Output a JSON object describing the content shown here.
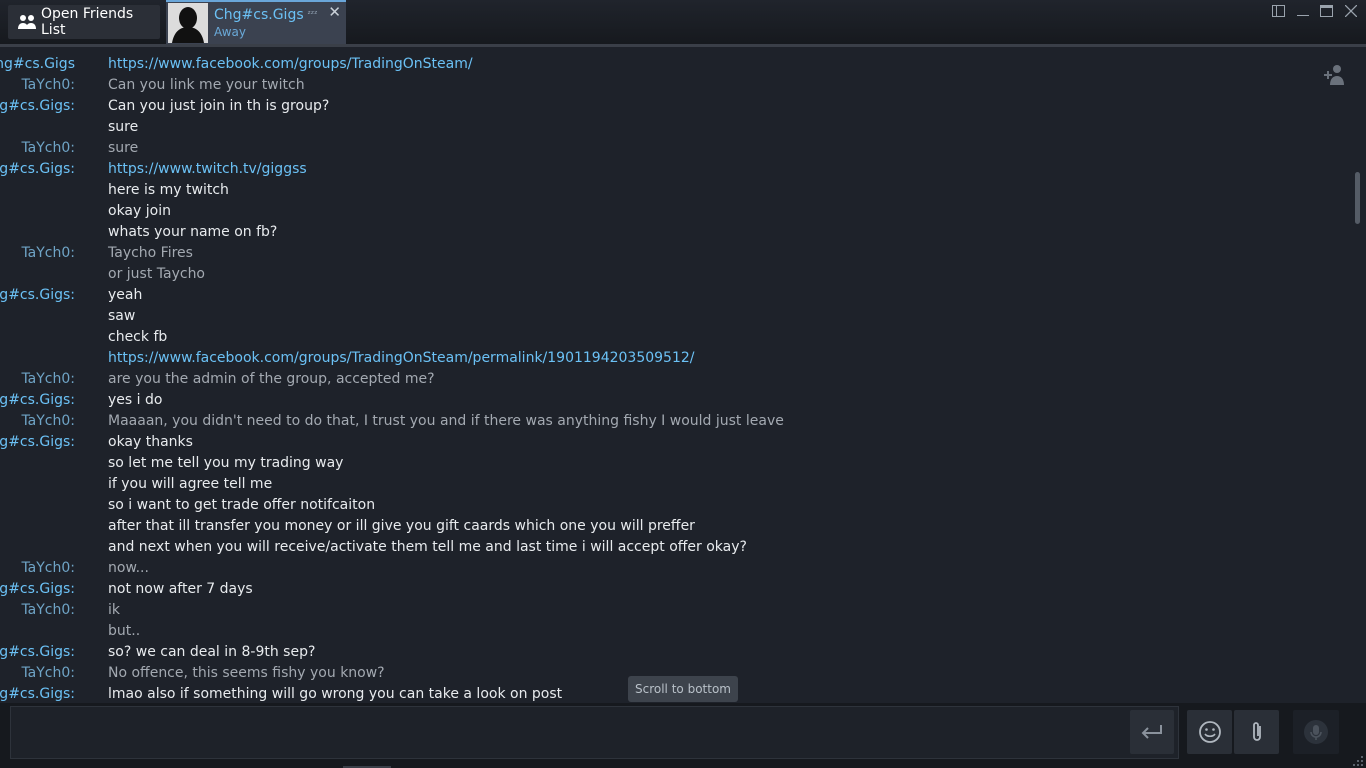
{
  "topbar": {
    "friends_button_label": "Open Friends List",
    "tab": {
      "name": "Chg#cs.Gigs",
      "status": "Away",
      "sleep_indicator": "ᶻᶻᶻ",
      "close_glyph": "✕"
    }
  },
  "chat": {
    "messages": [
      {
        "who": "Chg#cs.Gigs",
        "text": "https://www.facebook.com/groups/TradingOnSteam/",
        "side": "me",
        "link": true
      },
      {
        "who": "TaYch0:",
        "text": "Can you link me your twitch",
        "side": "them"
      },
      {
        "who": "Chg#cs.Gigs:",
        "text": "Can you just join in th is group?",
        "side": "me"
      },
      {
        "who": "",
        "text": "sure",
        "side": "me"
      },
      {
        "who": "TaYch0:",
        "text": "sure",
        "side": "them"
      },
      {
        "who": "Chg#cs.Gigs:",
        "text": "https://www.twitch.tv/giggss",
        "side": "me",
        "link": true
      },
      {
        "who": "",
        "text": "here is my twitch",
        "side": "me"
      },
      {
        "who": "",
        "text": "okay join",
        "side": "me"
      },
      {
        "who": "",
        "text": "whats your name on fb?",
        "side": "me"
      },
      {
        "who": "TaYch0:",
        "text": "Taycho Fires",
        "side": "them"
      },
      {
        "who": "",
        "text": "or just Taycho",
        "side": "them"
      },
      {
        "who": "Chg#cs.Gigs:",
        "text": "yeah",
        "side": "me"
      },
      {
        "who": "",
        "text": "saw",
        "side": "me"
      },
      {
        "who": "",
        "text": "check fb",
        "side": "me"
      },
      {
        "who": "",
        "text": "https://www.facebook.com/groups/TradingOnSteam/permalink/1901194203509512/",
        "side": "me",
        "link": true
      },
      {
        "who": "TaYch0:",
        "text": "are you the admin of the group, accepted me?",
        "side": "them"
      },
      {
        "who": "Chg#cs.Gigs:",
        "text": "yes i do",
        "side": "me"
      },
      {
        "who": "TaYch0:",
        "text": "Maaaan, you didn't need to do that, I trust you and if there was anything fishy I would just leave",
        "side": "them"
      },
      {
        "who": "Chg#cs.Gigs:",
        "text": "okay thanks",
        "side": "me"
      },
      {
        "who": "",
        "text": "so let me tell you my trading way",
        "side": "me"
      },
      {
        "who": "",
        "text": "if you will agree tell me",
        "side": "me"
      },
      {
        "who": "",
        "text": "so i want to get trade offer notifcaiton",
        "side": "me"
      },
      {
        "who": "",
        "text": "after that ill transfer you money or ill give you gift caards which one you will preffer",
        "side": "me"
      },
      {
        "who": "",
        "text": "and next when you will receive/activate them tell me and last time i will accept offer okay?",
        "side": "me"
      },
      {
        "who": "TaYch0:",
        "text": "now...",
        "side": "them"
      },
      {
        "who": "Chg#cs.Gigs:",
        "text": "not now after 7 days",
        "side": "me"
      },
      {
        "who": "TaYch0:",
        "text": "ik",
        "side": "them"
      },
      {
        "who": "",
        "text": "but..",
        "side": "them"
      },
      {
        "who": "Chg#cs.Gigs:",
        "text": "so? we can deal in 8-9th sep?",
        "side": "me"
      },
      {
        "who": "TaYch0:",
        "text": "No offence, this seems fishy you know?",
        "side": "them"
      },
      {
        "who": "Chg#cs.Gigs:",
        "text": "lmao also if something will go wrong you can take a look on post",
        "side": "me"
      }
    ],
    "scroll_to_bottom_label": "Scroll to bottom"
  },
  "composer": {
    "placeholder": ""
  },
  "colors": {
    "accent": "#6bc1f5",
    "background": "#1e222a"
  }
}
